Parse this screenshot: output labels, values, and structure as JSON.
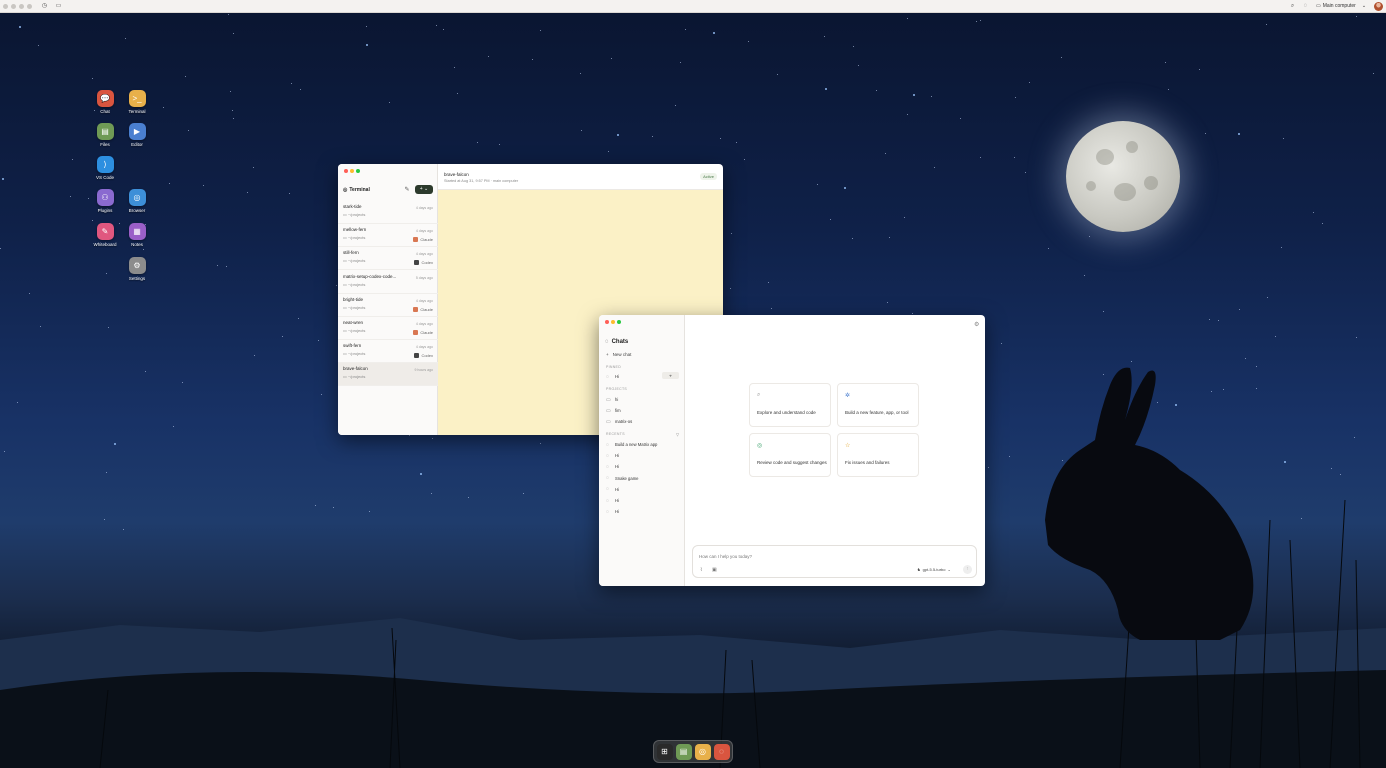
{
  "menubar": {
    "computer_label": "Main computer"
  },
  "desktop_icons": [
    {
      "label": "Chat",
      "icon": "chat-icon",
      "color": "#d9553f",
      "glyph": "💬"
    },
    {
      "label": "Terminal",
      "icon": "terminal-icon",
      "color": "#e8b04a",
      "glyph": ">_"
    },
    {
      "label": "Files",
      "icon": "files-icon",
      "color": "#6f9a55",
      "glyph": "▤"
    },
    {
      "label": "Editor",
      "icon": "editor-icon",
      "color": "#4a7fd0",
      "glyph": "▶"
    },
    {
      "label": "VS Code",
      "icon": "vscode-icon",
      "color": "#2d8fe0",
      "glyph": "⟩"
    },
    {
      "label": "Plugins",
      "icon": "plugins-icon",
      "color": "#8a6ad0",
      "glyph": "⚇"
    },
    {
      "label": "Browser",
      "icon": "browser-icon",
      "color": "#3d8fd8",
      "glyph": "◎"
    },
    {
      "label": "Whiteboard",
      "icon": "whiteboard-icon",
      "color": "#e0577f",
      "glyph": "✎"
    },
    {
      "label": "Notes",
      "icon": "notes-icon",
      "color": "#9a5fc8",
      "glyph": "▦"
    },
    {
      "label": "Settings",
      "icon": "settings-icon",
      "color": "#8c8c8c",
      "glyph": "⚙"
    }
  ],
  "terminal": {
    "title": "Terminal",
    "sessions": [
      {
        "name": "stark-tide",
        "dir": "~/projects",
        "ago": "4 days ago",
        "agent": ""
      },
      {
        "name": "mellow-fern",
        "dir": "~/projects",
        "ago": "4 days ago",
        "agent": "Claude"
      },
      {
        "name": "still-fern",
        "dir": "~/projects",
        "ago": "4 days ago",
        "agent": "Codex"
      },
      {
        "name": "matrix-setup-codex-code...",
        "dir": "~/projects",
        "ago": "5 days ago",
        "agent": ""
      },
      {
        "name": "bright-tide",
        "dir": "~/projects",
        "ago": "4 days ago",
        "agent": "Claude"
      },
      {
        "name": "neat-wren",
        "dir": "~/projects",
        "ago": "4 days ago",
        "agent": "Claude"
      },
      {
        "name": "swift-fern",
        "dir": "~/projects",
        "ago": "4 days ago",
        "agent": "Codex"
      },
      {
        "name": "brave-falcon",
        "dir": "~/projects",
        "ago": "9 hours ago",
        "agent": ""
      }
    ],
    "header_title": "brave-falcon",
    "header_sub": "Started at Aug 31, 9:57 PM · main computer",
    "status": "Active"
  },
  "chats": {
    "title": "Chats",
    "new_chat": "New chat",
    "pinned_header": "PINNED",
    "pinned": [
      "Hi"
    ],
    "projects_header": "PROJECTS",
    "projects": [
      "hi",
      "fim",
      "matrix-os"
    ],
    "recents_header": "RECENTS",
    "recents": [
      "Build a new Matrix app",
      "Hi",
      "Hi",
      "Snake game",
      "Hi",
      "Hi",
      "Hi"
    ],
    "cards": [
      {
        "label": "Explore and understand code",
        "icon": "search-icon",
        "glyph": "⌕",
        "color": "#999"
      },
      {
        "label": "Build a new feature, app, or tool",
        "icon": "build-icon",
        "glyph": "✲",
        "color": "#4a7fd0"
      },
      {
        "label": "Review code and suggest changes",
        "icon": "review-icon",
        "glyph": "◎",
        "color": "#3aa06a"
      },
      {
        "label": "Fix issues and failures",
        "icon": "fix-icon",
        "glyph": "☆",
        "color": "#e0a020"
      }
    ],
    "prompt_placeholder": "How can I help you today?",
    "model": "gpt-5.5-turbo"
  }
}
